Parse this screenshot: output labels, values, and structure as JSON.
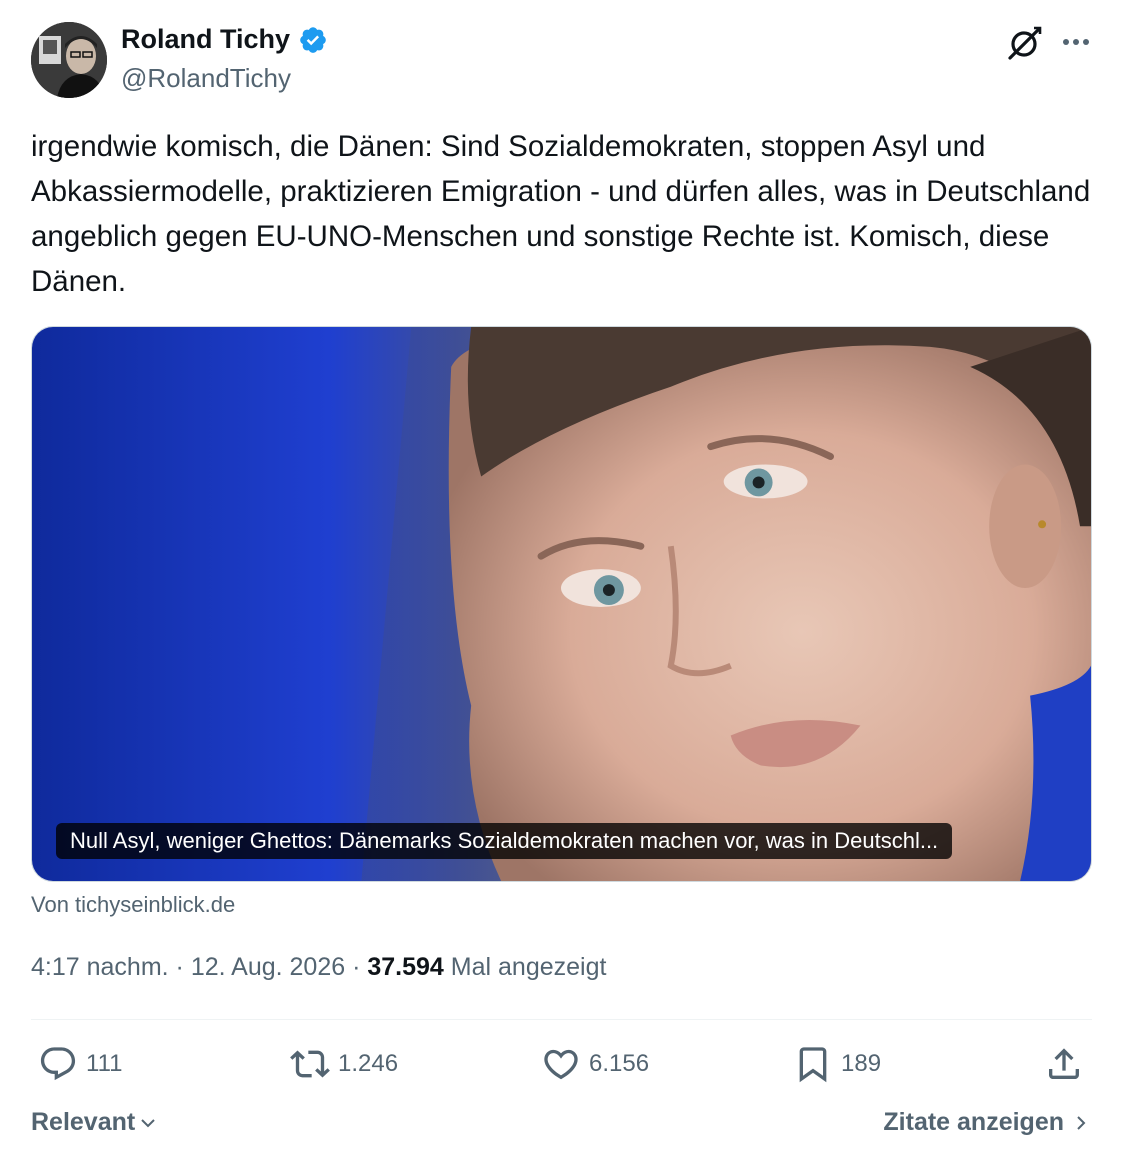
{
  "author": {
    "name": "Roland Tichy",
    "handle": "@RolandTichy",
    "verified": true
  },
  "tweet": {
    "text": "irgendwie komisch, die Dänen: Sind Sozialdemokraten, stoppen Asyl und Abkassiermodelle, praktizieren Emigration - und dürfen alles, was in Deutschland angeblich gegen EU-UNO-Menschen und sonstige Rechte ist. Komisch, diese Dänen."
  },
  "link_card": {
    "caption": "Null Asyl, weniger Ghettos: Dänemarks Sozialdemokraten machen vor, was in Deutschl...",
    "source": "Von tichyseinblick.de"
  },
  "meta": {
    "time": "4:17 nachm.",
    "separator": "·",
    "date": "12. Aug. 2026",
    "views_count": "37.594",
    "views_label": "Mal angezeigt"
  },
  "actions": {
    "replies": "111",
    "reposts": "1.246",
    "likes": "6.156",
    "bookmarks": "189"
  },
  "footer": {
    "sort_label": "Relevant",
    "quotes_label": "Zitate anzeigen"
  },
  "colors": {
    "text_primary": "#0f1419",
    "text_secondary": "#536471",
    "verified_blue": "#1d9bf0",
    "divider": "#eff3f4"
  },
  "icons": [
    "verified-badge-icon",
    "grok-icon",
    "more-icon",
    "reply-icon",
    "repost-icon",
    "like-icon",
    "bookmark-icon",
    "share-icon",
    "chevron-down-icon",
    "chevron-right-icon"
  ]
}
